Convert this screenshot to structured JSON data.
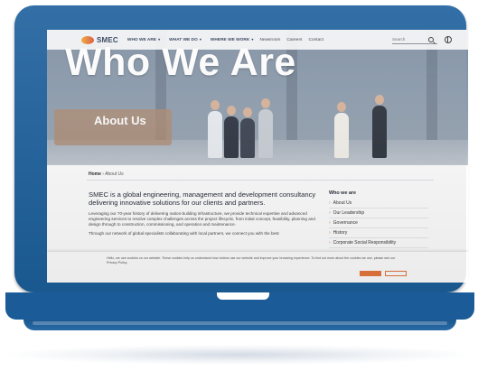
{
  "brand": {
    "name": "SMEC",
    "accent": "#e7773c",
    "shell_color": "#1c5f9c"
  },
  "nav": {
    "items": [
      {
        "label": "WHO WE ARE"
      },
      {
        "label": "WHAT WE DO"
      },
      {
        "label": "WHERE WE WORK"
      }
    ],
    "links": [
      "Newsroom",
      "Careers",
      "Contact"
    ],
    "search_placeholder": "Search",
    "icons": [
      "search-icon",
      "globe-icon",
      "chevron-down-icon"
    ]
  },
  "hero": {
    "title": "Who We Are",
    "subtitle": "About Us"
  },
  "breadcrumb": {
    "home": "Home",
    "separator": " › ",
    "current": "About Us"
  },
  "main": {
    "lead": "SMEC is a global engineering, management and development consultancy delivering innovative solutions for our clients and partners.",
    "paragraphs": [
      "Leveraging our 70-year history of delivering nation-building infrastructure, we provide technical expertise and advanced engineering services to resolve complex challenges across the project lifecycle, from initial concept, feasibility, planning and design through to construction, commissioning, and operation and maintenance.",
      "Through our network of global specialists collaborating with local partners, we connect you with the best"
    ]
  },
  "sidebar": {
    "title": "Who we are",
    "items": [
      {
        "label": "About Us"
      },
      {
        "label": "Our Leadership"
      },
      {
        "label": "Governance"
      },
      {
        "label": "History"
      },
      {
        "label": "Corporate Social Responsibility"
      }
    ]
  },
  "cookie": {
    "text": "Hello, we use cookies on our website. These cookies help us understand how visitors use our website and improve your browsing experience. To find out more about the cookies we use, please see our Privacy Policy."
  }
}
